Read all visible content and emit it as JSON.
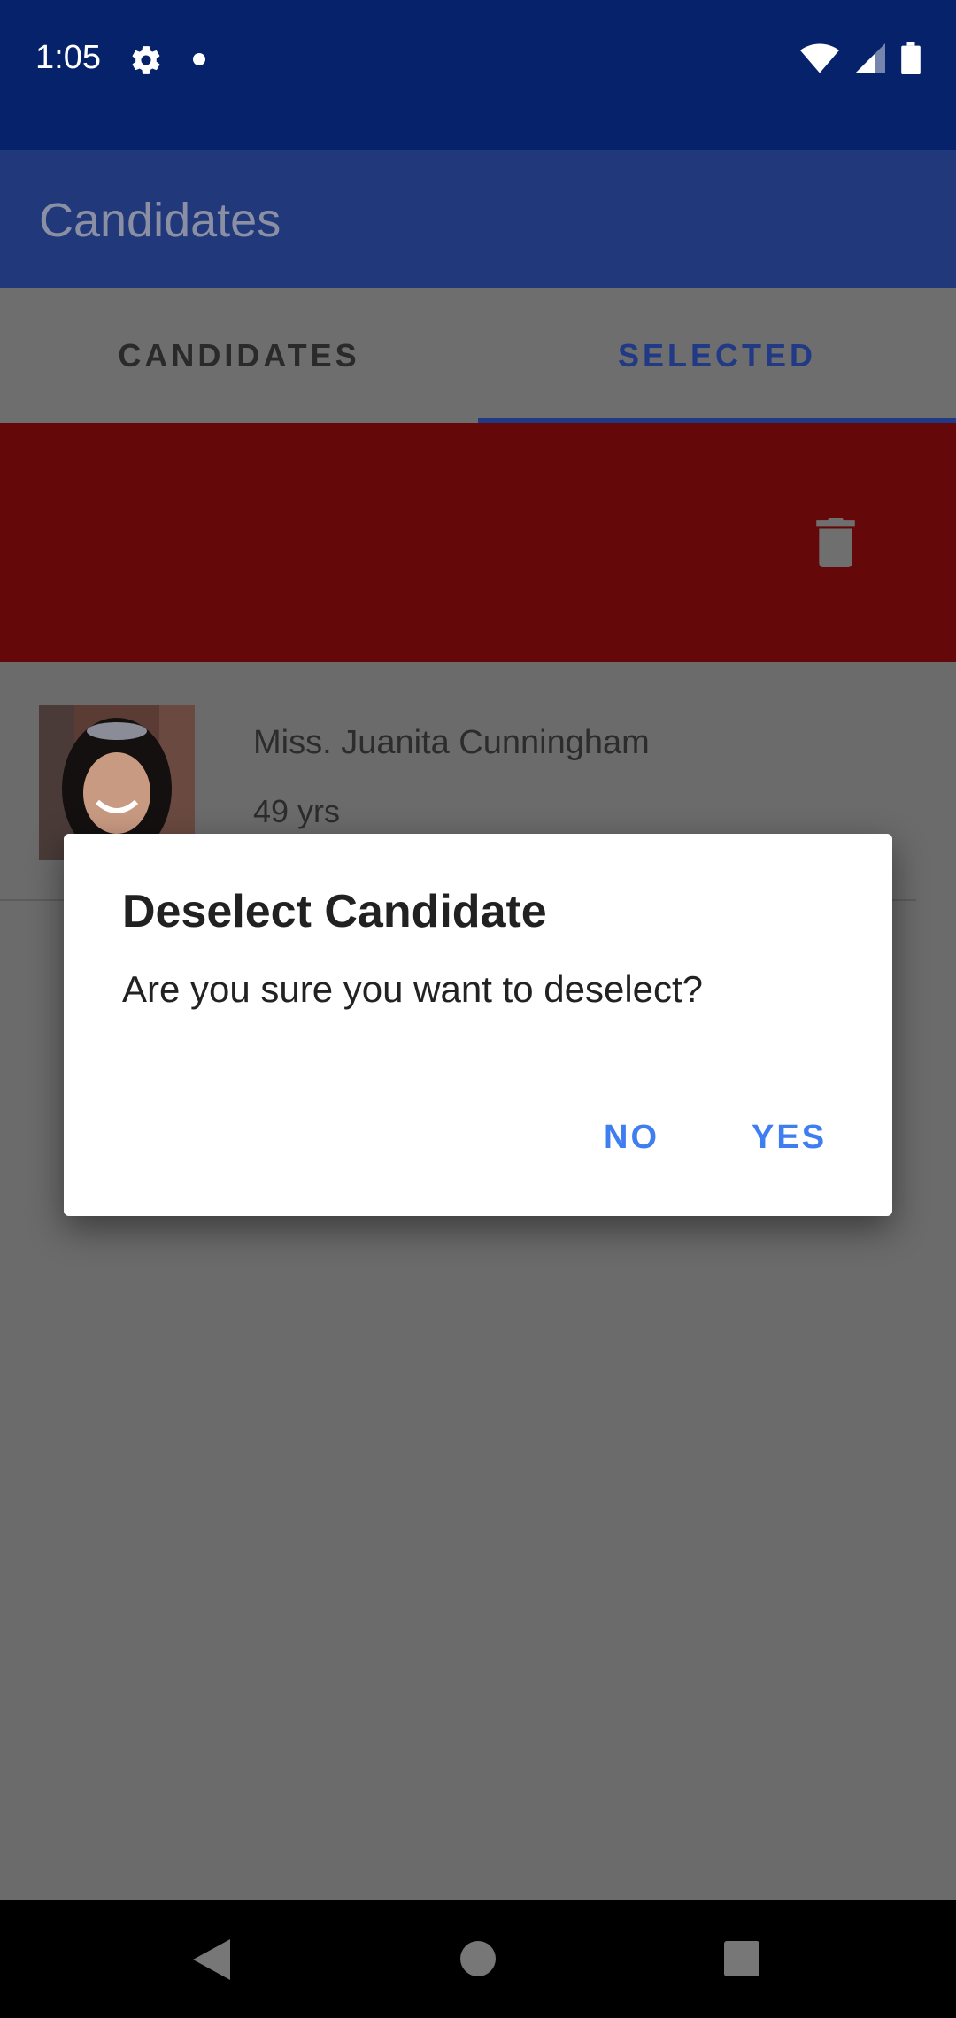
{
  "status_bar": {
    "time": "1:05"
  },
  "app_bar": {
    "title": "Candidates"
  },
  "tabs": [
    {
      "label": "CANDIDATES",
      "selected": false
    },
    {
      "label": "SELECTED",
      "selected": true
    }
  ],
  "candidate": {
    "name": "Miss. Juanita Cunningham",
    "age": "49 yrs"
  },
  "dialog": {
    "title": "Deselect Candidate",
    "message": "Are you sure you want to deselect?",
    "no_label": "NO",
    "yes_label": "YES"
  },
  "colors": {
    "status_bar": "#06226a",
    "app_bar": "#21397b",
    "swipe_delete": "#650809",
    "dialog_accent": "#3f7ef0"
  }
}
